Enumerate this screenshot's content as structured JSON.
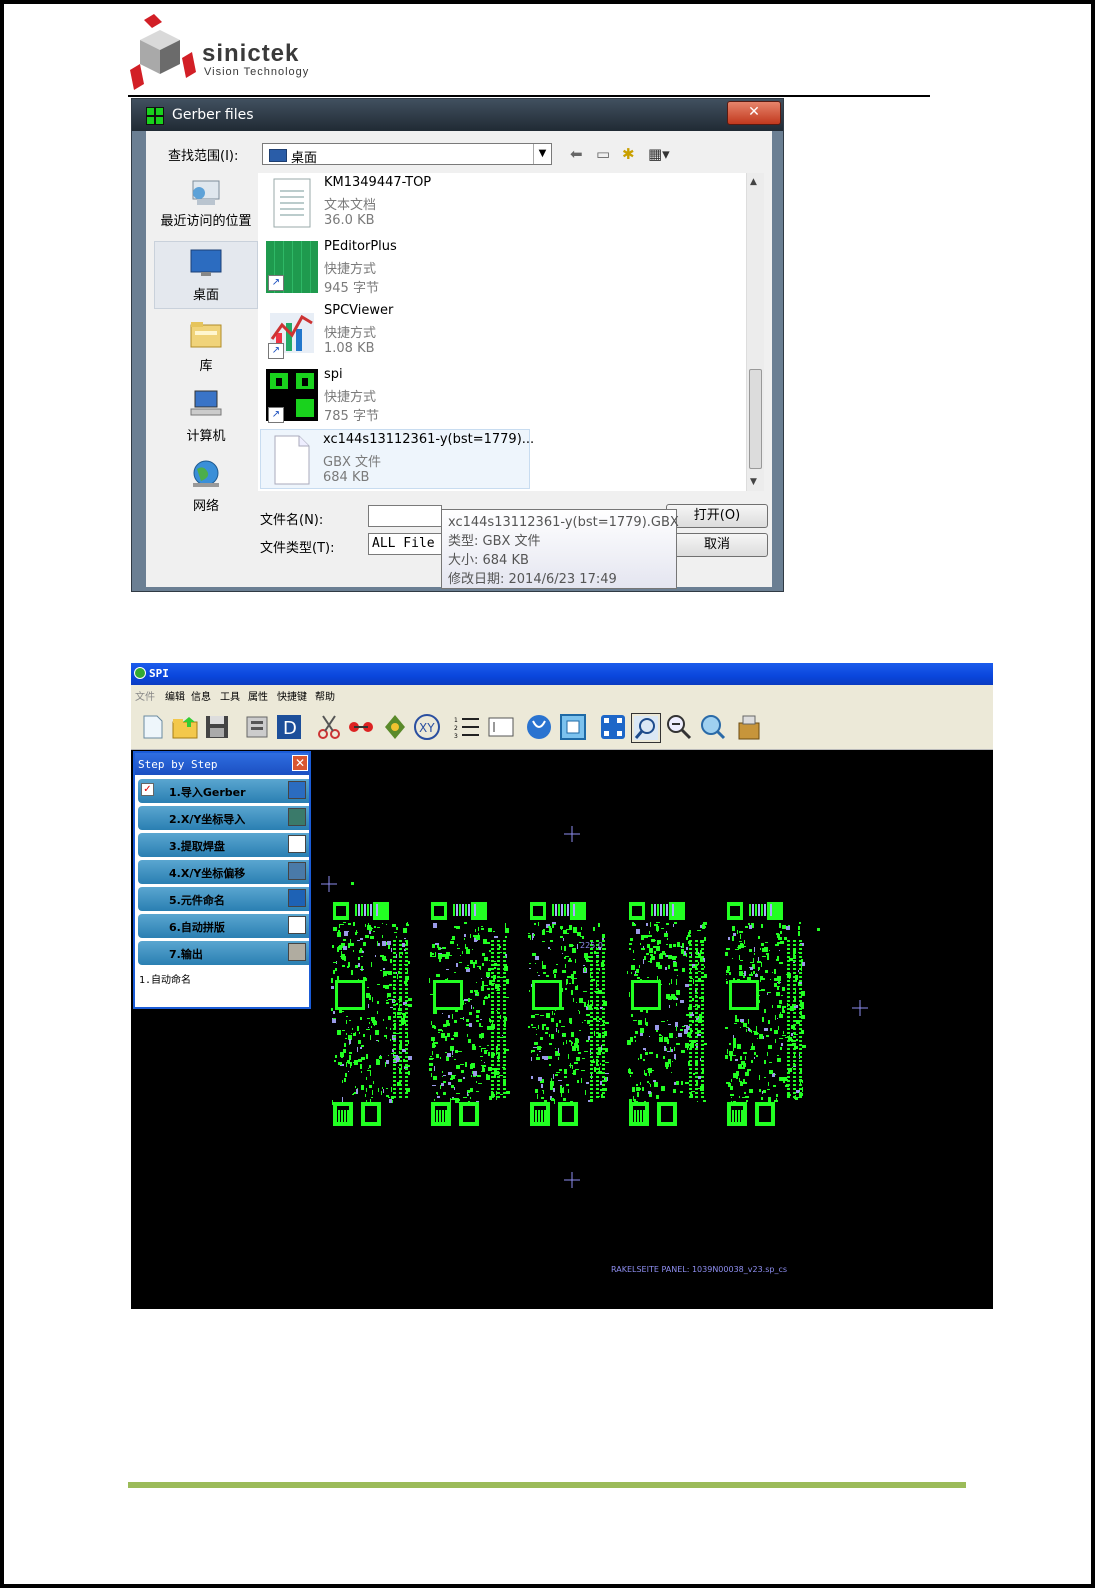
{
  "logo": {
    "brand": "sinictek",
    "tagline": "Vision Technology"
  },
  "dialog": {
    "title": "Gerber files",
    "look_in_label": "查找范围(I):",
    "look_in_value": "桌面",
    "places": [
      {
        "label": "最近访问的位置",
        "icon": "recent-places-icon"
      },
      {
        "label": "桌面",
        "icon": "desktop-icon"
      },
      {
        "label": "库",
        "icon": "library-folder-icon"
      },
      {
        "label": "计算机",
        "icon": "computer-icon"
      },
      {
        "label": "网络",
        "icon": "network-globe-icon"
      }
    ],
    "files": [
      {
        "name": "KM1349447-TOP",
        "type": "文本文档",
        "size": "36.0 KB",
        "icon": "text-document-icon"
      },
      {
        "name": "PEditorPlus",
        "type": "快捷方式",
        "size": "945 字节",
        "icon": "peditor-shortcut-icon"
      },
      {
        "name": "SPCViewer",
        "type": "快捷方式",
        "size": "1.08 KB",
        "icon": "spcviewer-shortcut-icon"
      },
      {
        "name": "spi",
        "type": "快捷方式",
        "size": "785 字节",
        "icon": "spi-shortcut-icon"
      },
      {
        "name": "xc144s13112361-y(bst=1779)...",
        "type": "GBX 文件",
        "size": "684 KB",
        "icon": "blank-file-icon"
      }
    ],
    "tooltip": {
      "line1": "xc144s13112361-y(bst=1779).GBX",
      "line2": "类型: GBX 文件",
      "line3": "大小: 684 KB",
      "line4": "修改日期: 2014/6/23 17:49"
    },
    "filename_label": "文件名(N):",
    "filename_value": "",
    "filetype_label": "文件类型(T):",
    "filetype_value": "ALL File",
    "open_label": "打开(O)",
    "cancel_label": "取消"
  },
  "spi": {
    "title": "SPI",
    "menu": [
      "文件",
      "编辑",
      "信息",
      "工具",
      "属性",
      "快捷键",
      "帮助"
    ],
    "step_panel": {
      "title": "Step by Step",
      "steps": [
        {
          "label": "1.导入Gerber",
          "checked": true
        },
        {
          "label": "2.X/Y坐标导入",
          "checked": false
        },
        {
          "label": "3.提取焊盘",
          "checked": false
        },
        {
          "label": "4.X/Y坐标偏移",
          "checked": false
        },
        {
          "label": "5.元件命名",
          "checked": false
        },
        {
          "label": "6.自动拼版",
          "checked": false
        },
        {
          "label": "7.输出",
          "checked": false
        }
      ],
      "info": "1.自动命名"
    },
    "canvas_label_top": "225.0",
    "canvas_label_bottom": "RAKELSEITE PANEL: 1039N00038_v23.sp_cs",
    "colors": {
      "pads": "#22ff22",
      "marks": "#8e8ef0",
      "background": "#000000"
    }
  }
}
